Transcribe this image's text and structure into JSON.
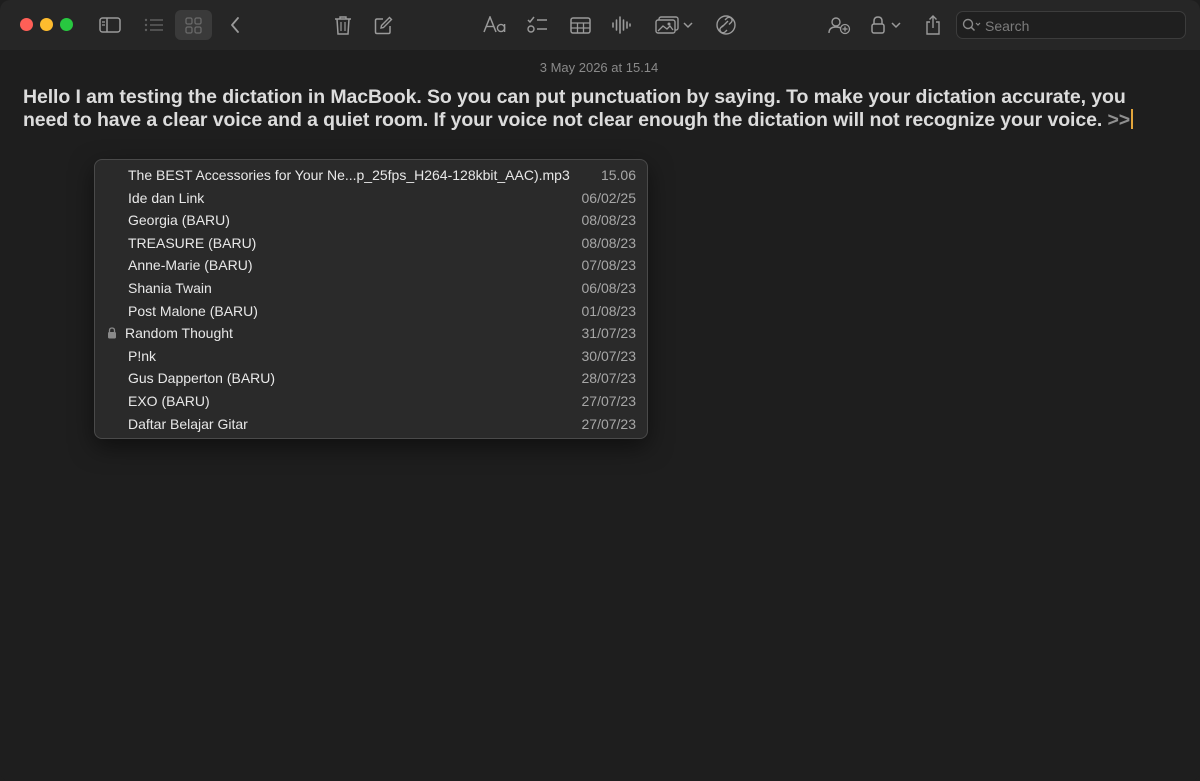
{
  "toolbar": {
    "search_placeholder": "Search",
    "icons": [
      "sidebar-icon",
      "list-view-icon",
      "gallery-view-icon",
      "back-icon",
      "trash-icon",
      "compose-icon",
      "format-text-icon",
      "checklist-icon",
      "table-icon",
      "audio-waveform-icon",
      "media-icon",
      "chevron-down-icon",
      "link-icon",
      "collaborate-icon",
      "lock-icon",
      "share-icon",
      "search-icon"
    ]
  },
  "note": {
    "date": "3 May 2026 at 15.14",
    "text": "Hello I am testing the dictation in MacBook. So you can put punctuation by saying. To make your dictation accurate, you need to have a clear voice and a quiet room. If your voice not clear enough the dictation will not recognize your voice. ",
    "link_prompt": ">>"
  },
  "link_suggestions": [
    {
      "title": "The BEST Accessories for Your Ne...p_25fps_H264-128kbit_AAC).mp3",
      "date": "15.06",
      "locked": false
    },
    {
      "title": "Ide dan Link",
      "date": "06/02/25",
      "locked": false
    },
    {
      "title": "Georgia (BARU)",
      "date": "08/08/23",
      "locked": false
    },
    {
      "title": "TREASURE (BARU)",
      "date": "08/08/23",
      "locked": false
    },
    {
      "title": "Anne-Marie (BARU)",
      "date": "07/08/23",
      "locked": false
    },
    {
      "title": "Shania Twain",
      "date": "06/08/23",
      "locked": false
    },
    {
      "title": "Post Malone (BARU)",
      "date": "01/08/23",
      "locked": false
    },
    {
      "title": "Random Thought",
      "date": "31/07/23",
      "locked": true
    },
    {
      "title": "P!nk",
      "date": "30/07/23",
      "locked": false
    },
    {
      "title": "Gus Dapperton (BARU)",
      "date": "28/07/23",
      "locked": false
    },
    {
      "title": "EXO (BARU)",
      "date": "27/07/23",
      "locked": false
    },
    {
      "title": "Daftar Belajar Gitar",
      "date": "27/07/23",
      "locked": false
    }
  ],
  "colors": {
    "background": "#1e1e1e",
    "toolbar": "#262626",
    "caret": "#e3a53b",
    "popup": "#2a2a2a"
  }
}
